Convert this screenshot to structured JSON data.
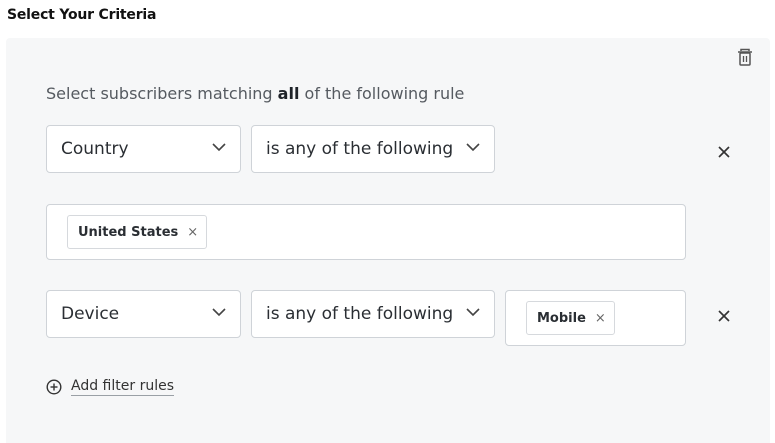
{
  "header": {
    "title": "Select Your Criteria"
  },
  "criteria": {
    "prefix": "Select subscribers matching ",
    "match_mode": "all",
    "suffix": " of the following rule"
  },
  "rules": [
    {
      "field": "Country",
      "operator": "is any of the following",
      "values": [
        "United States"
      ]
    },
    {
      "field": "Device",
      "operator": "is any of the following",
      "values": [
        "Mobile"
      ]
    }
  ],
  "tag_remove_glyph": "×",
  "add_filter_label": "Add filter rules",
  "icons": {
    "delete": "trash-icon",
    "remove_rule": "close-icon",
    "dropdown": "chevron-down-icon",
    "add": "plus-circle-icon"
  },
  "colors": {
    "panel_bg": "#f6f7f8",
    "border": "#cfd3d8",
    "text": "#2a2e33"
  }
}
